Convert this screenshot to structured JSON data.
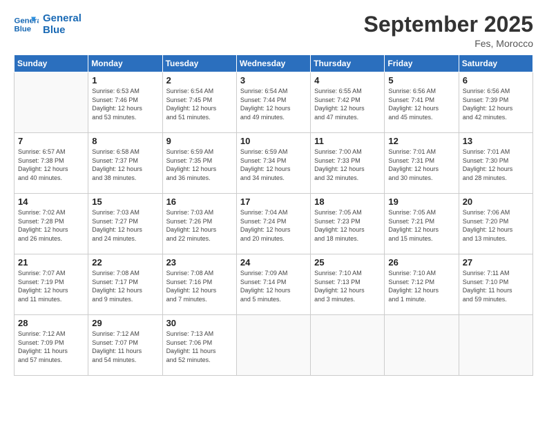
{
  "logo": {
    "line1": "General",
    "line2": "Blue"
  },
  "title": "September 2025",
  "subtitle": "Fes, Morocco",
  "days_of_week": [
    "Sunday",
    "Monday",
    "Tuesday",
    "Wednesday",
    "Thursday",
    "Friday",
    "Saturday"
  ],
  "weeks": [
    [
      {
        "day": "",
        "info": ""
      },
      {
        "day": "1",
        "info": "Sunrise: 6:53 AM\nSunset: 7:46 PM\nDaylight: 12 hours\nand 53 minutes."
      },
      {
        "day": "2",
        "info": "Sunrise: 6:54 AM\nSunset: 7:45 PM\nDaylight: 12 hours\nand 51 minutes."
      },
      {
        "day": "3",
        "info": "Sunrise: 6:54 AM\nSunset: 7:44 PM\nDaylight: 12 hours\nand 49 minutes."
      },
      {
        "day": "4",
        "info": "Sunrise: 6:55 AM\nSunset: 7:42 PM\nDaylight: 12 hours\nand 47 minutes."
      },
      {
        "day": "5",
        "info": "Sunrise: 6:56 AM\nSunset: 7:41 PM\nDaylight: 12 hours\nand 45 minutes."
      },
      {
        "day": "6",
        "info": "Sunrise: 6:56 AM\nSunset: 7:39 PM\nDaylight: 12 hours\nand 42 minutes."
      }
    ],
    [
      {
        "day": "7",
        "info": "Sunrise: 6:57 AM\nSunset: 7:38 PM\nDaylight: 12 hours\nand 40 minutes."
      },
      {
        "day": "8",
        "info": "Sunrise: 6:58 AM\nSunset: 7:37 PM\nDaylight: 12 hours\nand 38 minutes."
      },
      {
        "day": "9",
        "info": "Sunrise: 6:59 AM\nSunset: 7:35 PM\nDaylight: 12 hours\nand 36 minutes."
      },
      {
        "day": "10",
        "info": "Sunrise: 6:59 AM\nSunset: 7:34 PM\nDaylight: 12 hours\nand 34 minutes."
      },
      {
        "day": "11",
        "info": "Sunrise: 7:00 AM\nSunset: 7:33 PM\nDaylight: 12 hours\nand 32 minutes."
      },
      {
        "day": "12",
        "info": "Sunrise: 7:01 AM\nSunset: 7:31 PM\nDaylight: 12 hours\nand 30 minutes."
      },
      {
        "day": "13",
        "info": "Sunrise: 7:01 AM\nSunset: 7:30 PM\nDaylight: 12 hours\nand 28 minutes."
      }
    ],
    [
      {
        "day": "14",
        "info": "Sunrise: 7:02 AM\nSunset: 7:28 PM\nDaylight: 12 hours\nand 26 minutes."
      },
      {
        "day": "15",
        "info": "Sunrise: 7:03 AM\nSunset: 7:27 PM\nDaylight: 12 hours\nand 24 minutes."
      },
      {
        "day": "16",
        "info": "Sunrise: 7:03 AM\nSunset: 7:26 PM\nDaylight: 12 hours\nand 22 minutes."
      },
      {
        "day": "17",
        "info": "Sunrise: 7:04 AM\nSunset: 7:24 PM\nDaylight: 12 hours\nand 20 minutes."
      },
      {
        "day": "18",
        "info": "Sunrise: 7:05 AM\nSunset: 7:23 PM\nDaylight: 12 hours\nand 18 minutes."
      },
      {
        "day": "19",
        "info": "Sunrise: 7:05 AM\nSunset: 7:21 PM\nDaylight: 12 hours\nand 15 minutes."
      },
      {
        "day": "20",
        "info": "Sunrise: 7:06 AM\nSunset: 7:20 PM\nDaylight: 12 hours\nand 13 minutes."
      }
    ],
    [
      {
        "day": "21",
        "info": "Sunrise: 7:07 AM\nSunset: 7:19 PM\nDaylight: 12 hours\nand 11 minutes."
      },
      {
        "day": "22",
        "info": "Sunrise: 7:08 AM\nSunset: 7:17 PM\nDaylight: 12 hours\nand 9 minutes."
      },
      {
        "day": "23",
        "info": "Sunrise: 7:08 AM\nSunset: 7:16 PM\nDaylight: 12 hours\nand 7 minutes."
      },
      {
        "day": "24",
        "info": "Sunrise: 7:09 AM\nSunset: 7:14 PM\nDaylight: 12 hours\nand 5 minutes."
      },
      {
        "day": "25",
        "info": "Sunrise: 7:10 AM\nSunset: 7:13 PM\nDaylight: 12 hours\nand 3 minutes."
      },
      {
        "day": "26",
        "info": "Sunrise: 7:10 AM\nSunset: 7:12 PM\nDaylight: 12 hours\nand 1 minute."
      },
      {
        "day": "27",
        "info": "Sunrise: 7:11 AM\nSunset: 7:10 PM\nDaylight: 11 hours\nand 59 minutes."
      }
    ],
    [
      {
        "day": "28",
        "info": "Sunrise: 7:12 AM\nSunset: 7:09 PM\nDaylight: 11 hours\nand 57 minutes."
      },
      {
        "day": "29",
        "info": "Sunrise: 7:12 AM\nSunset: 7:07 PM\nDaylight: 11 hours\nand 54 minutes."
      },
      {
        "day": "30",
        "info": "Sunrise: 7:13 AM\nSunset: 7:06 PM\nDaylight: 11 hours\nand 52 minutes."
      },
      {
        "day": "",
        "info": ""
      },
      {
        "day": "",
        "info": ""
      },
      {
        "day": "",
        "info": ""
      },
      {
        "day": "",
        "info": ""
      }
    ]
  ]
}
